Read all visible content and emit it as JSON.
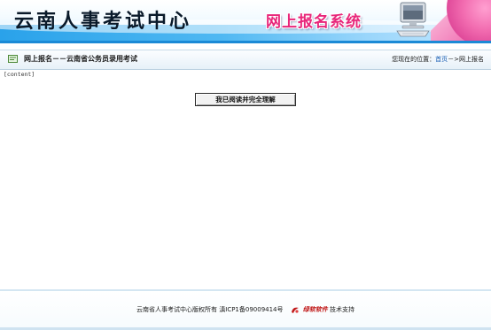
{
  "header": {
    "site_title": "云南人事考试中心",
    "system_title": "网上报名系统"
  },
  "navbar": {
    "title": "网上报名－－云南省公务员录用考试",
    "breadcrumb_prefix": "您现在的位置：",
    "breadcrumb_home": "首页",
    "breadcrumb_separator": "－>",
    "breadcrumb_current": "网上报名"
  },
  "content": {
    "placeholder": "[content]",
    "agree_button_label": "我已阅读并完全理解"
  },
  "footer": {
    "copyright": "云南省人事考试中心版权所有",
    "icp": "滇ICP1备09009414号",
    "vendor": "绿软软件",
    "support": "技术支持"
  },
  "colors": {
    "accent_blue": "#1b8ad6",
    "system_title_pink": "#e8267a",
    "link_blue": "#1a5fb4"
  }
}
